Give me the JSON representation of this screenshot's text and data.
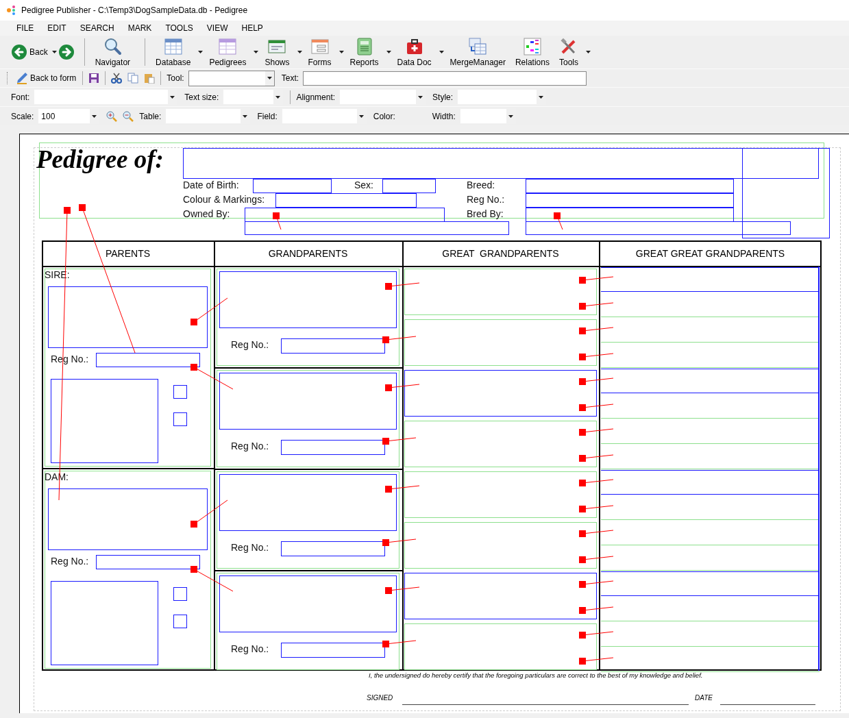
{
  "window": {
    "title": "Pedigree Publisher - C:\\Temp3\\DogSampleData.db - Pedigree"
  },
  "menu": [
    "FILE",
    "EDIT",
    "SEARCH",
    "MARK",
    "TOOLS",
    "VIEW",
    "HELP"
  ],
  "nav": {
    "back": "Back",
    "back_dropdown": true
  },
  "toolbar": [
    {
      "label": "Navigator",
      "kind": "search",
      "dropdown": false
    },
    {
      "label": "Database",
      "kind": "grid",
      "dropdown": true
    },
    {
      "label": "Pedigrees",
      "kind": "pedigree",
      "dropdown": true
    },
    {
      "label": "Shows",
      "kind": "shows",
      "dropdown": true
    },
    {
      "label": "Forms",
      "kind": "forms",
      "dropdown": true
    },
    {
      "label": "Reports",
      "kind": "reports",
      "dropdown": true
    },
    {
      "label": "Data Doc",
      "kind": "kit",
      "dropdown": true
    },
    {
      "label": "MergeManager",
      "kind": "merge",
      "dropdown": false
    },
    {
      "label": "Relations",
      "kind": "relations",
      "dropdown": false
    },
    {
      "label": "Tools",
      "kind": "tools",
      "dropdown": true
    }
  ],
  "edit_bar": {
    "back_to_form": "Back to form",
    "tool_label": "Tool:",
    "text_label": "Text:"
  },
  "format_bar": {
    "font": "Font:",
    "text_size": "Text size:",
    "alignment": "Alignment:",
    "style": "Style:"
  },
  "scale_bar": {
    "scale": "Scale:",
    "scale_value": "100",
    "table": "Table:",
    "field": "Field:",
    "color_label": "Color:",
    "width": "Width:"
  },
  "form": {
    "title": "Pedigree of:",
    "header_fields": [
      {
        "label": "Date of Birth:"
      },
      {
        "label": "Sex:"
      },
      {
        "label": "Breed:"
      },
      {
        "label": "Colour & Markings:"
      },
      {
        "label": "Reg No.:"
      },
      {
        "label": "Owned By:"
      },
      {
        "label": "Bred By:"
      }
    ],
    "columns": [
      "PARENTS",
      "GRANDPARENTS",
      "GREAT  GRANDPARENTS",
      "GREAT GREAT GRANDPARENTS"
    ],
    "parents": [
      {
        "label": "SIRE:",
        "reg_label": "Reg No.:"
      },
      {
        "label": "DAM:",
        "reg_label": "Reg No.:"
      }
    ],
    "grandparents": [
      {
        "reg_label": "Reg No.:"
      },
      {
        "reg_label": "Reg No.:"
      },
      {
        "reg_label": "Reg No.:"
      },
      {
        "reg_label": "Reg No.:"
      }
    ],
    "certification": "I, the undersigned do hereby certify that the foregoing particulars are correct to the best of my knowledge and belief.",
    "signed": "SIGNED",
    "date": "DATE"
  }
}
